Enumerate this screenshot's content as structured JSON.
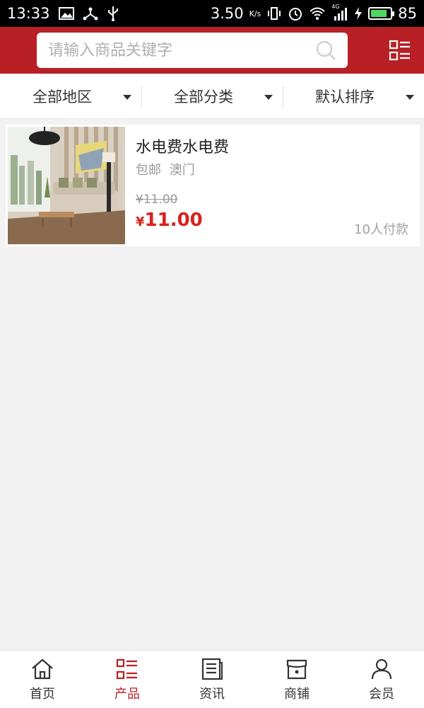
{
  "status_bar": {
    "time": "13:33",
    "speed": "3.50",
    "speed_unit": "K/s",
    "network": "4G",
    "battery": "85",
    "battery_level": 0.85
  },
  "search": {
    "placeholder": "请输入商品关键字"
  },
  "filters": [
    {
      "label": "全部地区"
    },
    {
      "label": "全部分类"
    },
    {
      "label": "默认排序"
    }
  ],
  "products": [
    {
      "title": "水电费水电费",
      "shipping": "包邮",
      "location": "澳门",
      "old_price": "¥11.00",
      "price_symbol": "¥",
      "price": "11.00",
      "paid_count": "10人付款"
    }
  ],
  "bottom_nav": [
    {
      "label": "首页",
      "icon": "home-icon",
      "active": false
    },
    {
      "label": "产品",
      "icon": "list-icon",
      "active": true
    },
    {
      "label": "资讯",
      "icon": "news-icon",
      "active": false
    },
    {
      "label": "商铺",
      "icon": "store-icon",
      "active": false
    },
    {
      "label": "会员",
      "icon": "user-icon",
      "active": false
    }
  ],
  "colors": {
    "brand": "#b82025",
    "price": "#d7231e",
    "background": "#f2f2f2"
  }
}
